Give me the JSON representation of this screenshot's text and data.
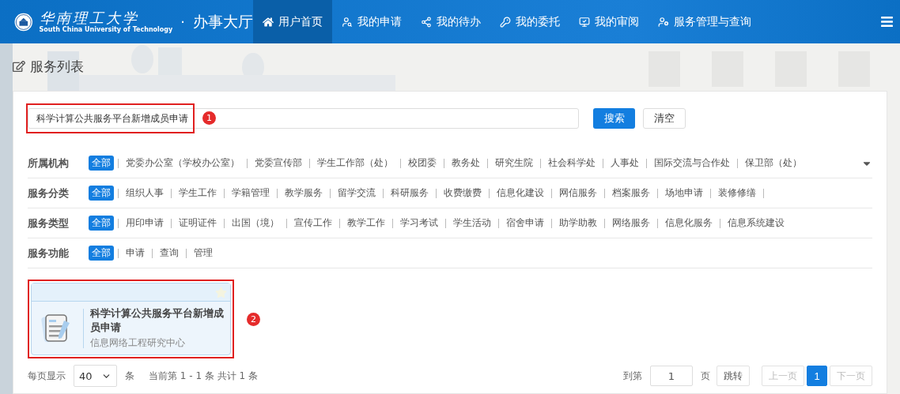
{
  "header": {
    "logo_name": "华南理工大学",
    "logo_subtitle": "South China University of Technology",
    "separator": "·",
    "app_title": "办事大厅"
  },
  "nav": [
    {
      "label": "用户首页",
      "selected": true
    },
    {
      "label": "我的申请",
      "selected": false
    },
    {
      "label": "我的待办",
      "selected": false
    },
    {
      "label": "我的委托",
      "selected": false
    },
    {
      "label": "我的审阅",
      "selected": false
    },
    {
      "label": "服务管理与查询",
      "selected": false
    }
  ],
  "page_title": "服务列表",
  "search": {
    "value": "科学计算公共服务平台新增成员申请",
    "annotation": "1",
    "search_button": "搜索",
    "clear_button": "清空"
  },
  "filters": [
    {
      "label": "所属机构",
      "expandable": true,
      "options": [
        {
          "label": "全部",
          "selected": true
        },
        {
          "label": "党委办公室（学校办公室）",
          "selected": false
        },
        {
          "label": "党委宣传部",
          "selected": false
        },
        {
          "label": "学生工作部（处）",
          "selected": false
        },
        {
          "label": "校团委",
          "selected": false
        },
        {
          "label": "教务处",
          "selected": false
        },
        {
          "label": "研究生院",
          "selected": false
        },
        {
          "label": "社会科学处",
          "selected": false
        },
        {
          "label": "人事处",
          "selected": false
        },
        {
          "label": "国际交流与合作处",
          "selected": false
        },
        {
          "label": "保卫部（处）",
          "selected": false
        }
      ]
    },
    {
      "label": "服务分类",
      "expandable": false,
      "options": [
        {
          "label": "全部",
          "selected": true
        },
        {
          "label": "组织人事",
          "selected": false
        },
        {
          "label": "学生工作",
          "selected": false
        },
        {
          "label": "学籍管理",
          "selected": false
        },
        {
          "label": "教学服务",
          "selected": false
        },
        {
          "label": "留学交流",
          "selected": false
        },
        {
          "label": "科研服务",
          "selected": false
        },
        {
          "label": "收费缴费",
          "selected": false
        },
        {
          "label": "信息化建设",
          "selected": false
        },
        {
          "label": "网信服务",
          "selected": false
        },
        {
          "label": "档案服务",
          "selected": false
        },
        {
          "label": "场地申请",
          "selected": false
        },
        {
          "label": "装修修缮",
          "selected": false
        }
      ]
    },
    {
      "label": "服务类型",
      "expandable": false,
      "options": [
        {
          "label": "全部",
          "selected": true
        },
        {
          "label": "用印申请",
          "selected": false
        },
        {
          "label": "证明证件",
          "selected": false
        },
        {
          "label": "出国（境）",
          "selected": false
        },
        {
          "label": "宣传工作",
          "selected": false
        },
        {
          "label": "教学工作",
          "selected": false
        },
        {
          "label": "学习考试",
          "selected": false
        },
        {
          "label": "学生活动",
          "selected": false
        },
        {
          "label": "宿舍申请",
          "selected": false
        },
        {
          "label": "助学助教",
          "selected": false
        },
        {
          "label": "网络服务",
          "selected": false
        },
        {
          "label": "信息化服务",
          "selected": false
        },
        {
          "label": "信息系统建设",
          "selected": false
        }
      ]
    },
    {
      "label": "服务功能",
      "expandable": false,
      "options": [
        {
          "label": "全部",
          "selected": true
        },
        {
          "label": "申请",
          "selected": false
        },
        {
          "label": "查询",
          "selected": false
        },
        {
          "label": "管理",
          "selected": false
        }
      ]
    }
  ],
  "cards": [
    {
      "title": "科学计算公共服务平台新增成员申请",
      "department": "信息网络工程研究中心",
      "favorite": false,
      "annotation": "2"
    }
  ],
  "pagination": {
    "per_page_label": "每页显示",
    "per_page": "40",
    "unit": "条",
    "summary": "当前第 1 - 1 条 共计 1 条",
    "goto_label": "到第",
    "goto_value": "1",
    "page_unit": "页",
    "jump": "跳转",
    "prev": "上一页",
    "prev_disabled": true,
    "pages": [
      {
        "label": "1",
        "selected": true
      }
    ],
    "next": "下一页",
    "next_disabled": true
  }
}
